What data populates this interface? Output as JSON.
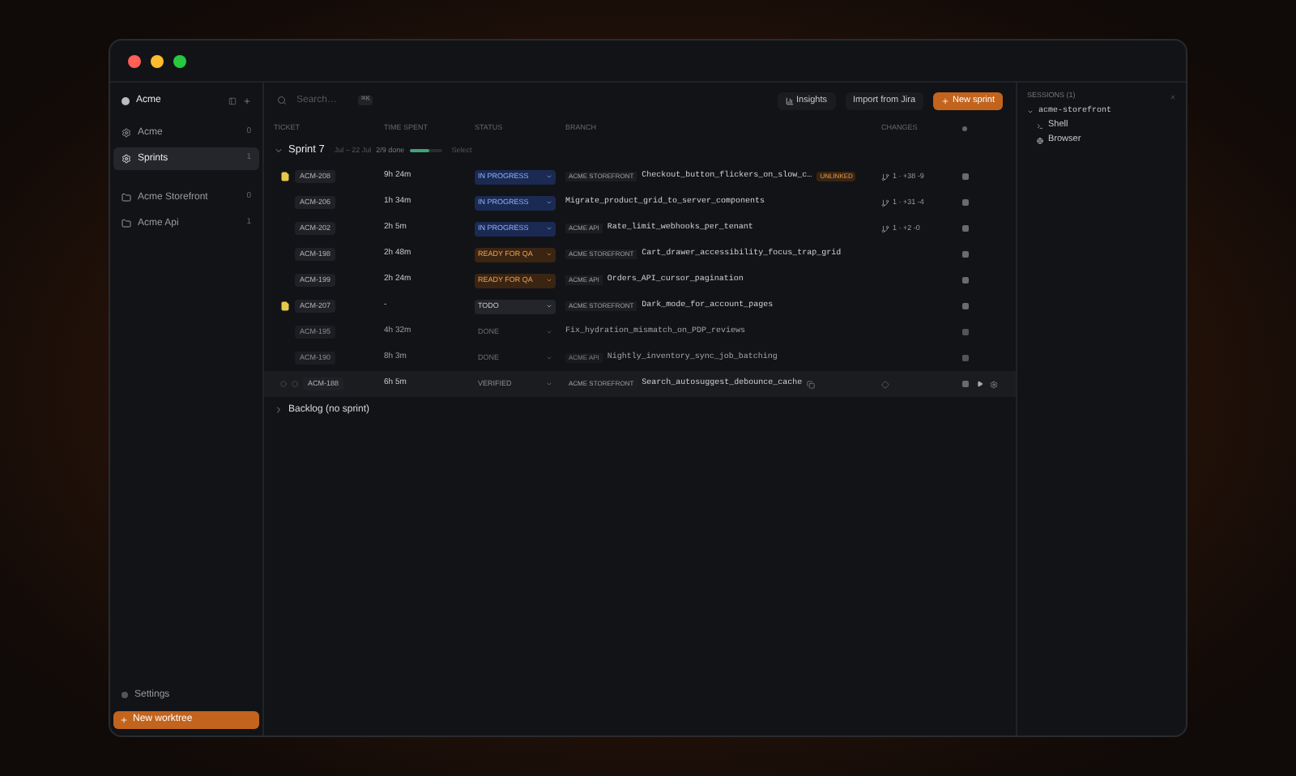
{
  "window": {
    "workspace": "Acme"
  },
  "sidebar": {
    "items": [
      {
        "label": "Acme",
        "count": "0",
        "kind": "gear",
        "selected": false
      },
      {
        "label": "Sprints",
        "count": "1",
        "kind": "gear",
        "selected": true
      },
      {
        "label": "Acme Storefront",
        "count": "0",
        "kind": "folder",
        "selected": false
      },
      {
        "label": "Acme Api",
        "count": "1",
        "kind": "folder",
        "selected": false
      }
    ],
    "settings": "Settings",
    "new_button": "New worktree"
  },
  "toolbar": {
    "placeholder": "Search…",
    "shortcut": "⌘K",
    "buttons": [
      {
        "label": "Insights",
        "kind": "chart"
      },
      {
        "label": "Import from Jira",
        "kind": "plain"
      },
      {
        "label": "New sprint",
        "kind": "primary"
      }
    ]
  },
  "table": {
    "columns": [
      "TICKET",
      "TIME SPENT",
      "STATUS",
      "BRANCH",
      "CHANGES"
    ],
    "sprint": {
      "name": "Sprint 7",
      "expanded": true,
      "dates": "Jul – 22 Jul",
      "progress": "2/9 done",
      "level": 0.6,
      "action": "Select"
    },
    "rows": [
      {
        "ticket": "ACM-208",
        "flagged": true,
        "time": "9h 24m",
        "status": {
          "text": "IN PROGRESS",
          "kind": "progress"
        },
        "repo": "ACME STOREFRONT",
        "branch": "Checkout_button_flickers_on_slow_c…",
        "badge": "UNLINKED",
        "changes": "1 · +38 -9",
        "dimmed": false,
        "active": false
      },
      {
        "ticket": "ACM-206",
        "flagged": false,
        "time": "1h 34m",
        "status": {
          "text": "IN PROGRESS",
          "kind": "progress"
        },
        "branch": "Migrate_product_grid_to_server_components",
        "changes": "1 · +31 -4",
        "dimmed": false,
        "active": false
      },
      {
        "ticket": "ACM-202",
        "flagged": false,
        "time": "2h 5m",
        "status": {
          "text": "IN PROGRESS",
          "kind": "progress"
        },
        "repo": "ACME API",
        "branch": "Rate_limit_webhooks_per_tenant",
        "changes": "1 · +2 -0",
        "dimmed": false,
        "active": false
      },
      {
        "ticket": "ACM-198",
        "flagged": false,
        "time": "2h 48m",
        "status": {
          "text": "READY FOR QA",
          "kind": "ready"
        },
        "repo": "ACME STOREFRONT",
        "branch": "Cart_drawer_accessibility_focus_trap_grid",
        "dimmed": false,
        "active": false
      },
      {
        "ticket": "ACM-199",
        "flagged": false,
        "time": "2h 24m",
        "status": {
          "text": "READY FOR QA",
          "kind": "ready"
        },
        "repo": "ACME API",
        "branch": "Orders_API_cursor_pagination",
        "dimmed": false,
        "active": false
      },
      {
        "ticket": "ACM-207",
        "flagged": true,
        "time": "-",
        "status": {
          "text": "TODO",
          "kind": "todo"
        },
        "repo": "ACME STOREFRONT",
        "branch": "Dark_mode_for_account_pages",
        "dimmed": false,
        "active": false
      },
      {
        "ticket": "ACM-195",
        "flagged": false,
        "time": "4h 32m",
        "status": {
          "text": "DONE",
          "kind": "done"
        },
        "branch": "Fix_hydration_mismatch_on_PDP_reviews",
        "dimmed": true,
        "active": false
      },
      {
        "ticket": "ACM-190",
        "flagged": false,
        "time": "8h 3m",
        "status": {
          "text": "DONE",
          "kind": "done"
        },
        "repo": "ACME API",
        "branch": "Nightly_inventory_sync_job_batching",
        "dimmed": true,
        "active": false
      },
      {
        "ticket": "ACM-188",
        "flagged": false,
        "time": "6h 5m",
        "status": {
          "text": "VERIFIED",
          "kind": "done"
        },
        "repo": "ACME STOREFRONT",
        "branch": "Search_autosuggest_debounce_cache",
        "dimmed": false,
        "active": true
      }
    ],
    "backlog": "Backlog (no sprint)"
  },
  "sessions": {
    "title": "SESSIONS (1)",
    "group": {
      "label": "acme-storefront",
      "expanded": true,
      "children": [
        {
          "label": "Shell",
          "kind": "shell"
        },
        {
          "label": "Browser",
          "kind": "browser"
        }
      ]
    }
  }
}
